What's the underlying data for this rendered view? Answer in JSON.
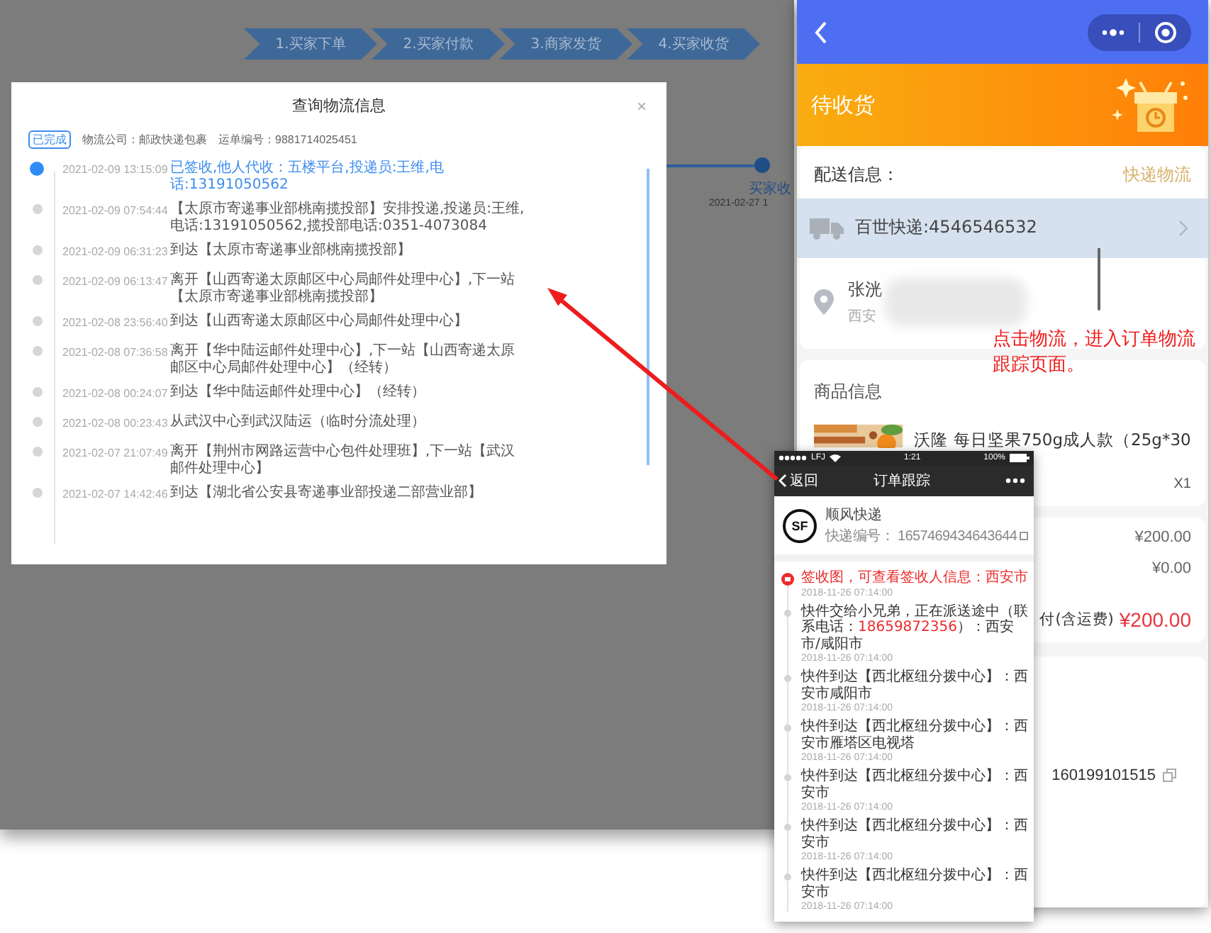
{
  "background_page": {
    "steps": [
      {
        "label": "1.买家下单"
      },
      {
        "label": "2.买家付款"
      },
      {
        "label": "3.商家发货"
      },
      {
        "label": "4.买家收货"
      }
    ],
    "progress": {
      "label": "买家收",
      "time": "2021-02-27 1"
    }
  },
  "logistics_dialog": {
    "title": "查询物流信息",
    "close": "×",
    "status_tag": "已完成",
    "company": "物流公司：邮政快递包裹",
    "waybill": "运单编号：9881714025451",
    "events": [
      {
        "time": "2021-02-09 13:15:09",
        "text": "已签收,他人代收：五楼平台,投递员:王维,电话:13191050562",
        "current": true
      },
      {
        "time": "2021-02-09 07:54:44",
        "text": "【太原市寄递事业部桃南揽投部】安排投递,投递员:王维,电话:13191050562,揽投部电话:0351-4073084",
        "current": false
      },
      {
        "time": "2021-02-09 06:31:23",
        "text": "到达【太原市寄递事业部桃南揽投部】",
        "current": false
      },
      {
        "time": "2021-02-09 06:13:47",
        "text": "离开【山西寄递太原邮区中心局邮件处理中心】,下一站【太原市寄递事业部桃南揽投部】",
        "current": false
      },
      {
        "time": "2021-02-08 23:56:40",
        "text": "到达【山西寄递太原邮区中心局邮件处理中心】",
        "current": false
      },
      {
        "time": "2021-02-08 07:36:58",
        "text": "离开【华中陆运邮件处理中心】,下一站【山西寄递太原邮区中心局邮件处理中心】（经转）",
        "current": false
      },
      {
        "time": "2021-02-08 00:24:07",
        "text": "到达【华中陆运邮件处理中心】（经转）",
        "current": false
      },
      {
        "time": "2021-02-08 00:23:43",
        "text": "从武汉中心到武汉陆运（临时分流处理）",
        "current": false
      },
      {
        "time": "2021-02-07 21:07:49",
        "text": "离开【荆州市网路运营中心包件处理班】,下一站【武汉邮件处理中心】",
        "current": false
      },
      {
        "time": "2021-02-07 14:42:46",
        "text": "到达【湖北省公安县寄递事业部投递二部营业部】",
        "current": false
      }
    ]
  },
  "order_phone": {
    "status_title": "待收货",
    "delivery_label": "配送信息：",
    "delivery_link": "快递物流",
    "courier": "百世快递:4546546532",
    "recipient_name": "张洸",
    "recipient_address": "西安",
    "annotation": "点击物流，进入订单物流跟踪页面。",
    "goods_label": "商品信息",
    "product": {
      "kind": "picture",
      "title": "沃隆 每日坚果750g成人款（25g*30",
      "quantity": "X1"
    },
    "price_rows": [
      {
        "kind": "plain",
        "value": "¥200.00"
      },
      {
        "kind": "plain",
        "value": "¥0.00"
      },
      {
        "kind": "total",
        "label": "付(含运费)",
        "value": "¥200.00"
      }
    ],
    "order_number": "160199101515"
  },
  "tracking_phone": {
    "status_bar": {
      "carrier": "LFJ",
      "time": "1:21",
      "battery": "100%"
    },
    "back": "返回",
    "title": "订单跟踪",
    "logo_text": "SF",
    "courier_name": "顺风快递",
    "number": "快递编号： 1657469434643644",
    "events": [
      {
        "kind": "signed",
        "parts": [
          {
            "text": "签收图，可查看签收人信息：西安市"
          }
        ],
        "time": "2018-11-26 07:14:00"
      },
      {
        "kind": "normal",
        "parts": [
          {
            "text": "快件交给小兄弟，正在派送途中（联系电话："
          },
          {
            "text": "18659872356",
            "highlight": true
          },
          {
            "text": "）：西安市/咸阳市"
          }
        ],
        "time": "2018-11-26 07:14:00"
      },
      {
        "kind": "normal",
        "parts": [
          {
            "text": "快件到达【西北枢纽分拨中心】：西安市咸阳市"
          }
        ],
        "time": "2018-11-26 07:14:00"
      },
      {
        "kind": "normal",
        "parts": [
          {
            "text": "快件到达【西北枢纽分拨中心】：西安市雁塔区电视塔"
          }
        ],
        "time": "2018-11-26 07:14:00"
      },
      {
        "kind": "normal",
        "parts": [
          {
            "text": "快件到达【西北枢纽分拨中心】：西安市"
          }
        ],
        "time": "2018-11-26 07:14:00"
      },
      {
        "kind": "normal",
        "parts": [
          {
            "text": "快件到达【西北枢纽分拨中心】：西安市"
          }
        ],
        "time": "2018-11-26 07:14:00"
      },
      {
        "kind": "normal",
        "parts": [
          {
            "text": "快件到达【西北枢纽分拨中心】：西安市"
          }
        ],
        "time": "2018-11-26 07:14:00"
      }
    ]
  }
}
